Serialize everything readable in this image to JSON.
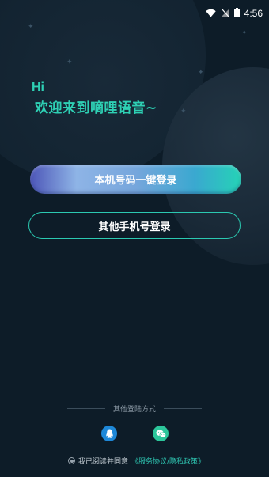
{
  "status_bar": {
    "time": "4:56",
    "icons": [
      "wifi-icon",
      "signal-off-icon",
      "battery-icon"
    ]
  },
  "greeting": {
    "hi": "Hi",
    "welcome": "欢迎来到嘀哩语音~"
  },
  "buttons": {
    "one_click_login": "本机号码一键登录",
    "other_phone_login": "其他手机号登录"
  },
  "other_login": {
    "label": "其他登陆方式",
    "options": [
      "qq-icon",
      "wechat-icon"
    ]
  },
  "agreement": {
    "prefix": "我已阅读并同意",
    "link": "《服务协议/隐私政策》"
  },
  "colors": {
    "background": "#0d1c28",
    "accent": "#2ed0b4",
    "qq": "#1e88d8",
    "wechat": "#2cc69b"
  }
}
